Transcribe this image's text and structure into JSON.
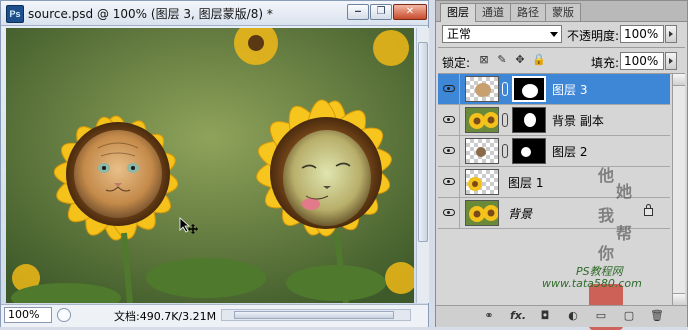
{
  "document": {
    "title": "source.psd @ 100% (图层 3, 图层蒙版/8) *",
    "app_icon": "Ps",
    "zoom": "100%",
    "doc_info": "文档:490.7K/3.21M",
    "buttons": {
      "minimize": "‒",
      "restore": "❐",
      "close": "✕"
    }
  },
  "panel": {
    "tabs": [
      {
        "label": "图层"
      },
      {
        "label": "通道"
      },
      {
        "label": "路径"
      },
      {
        "label": "蒙版"
      }
    ],
    "blend_mode": "正常",
    "opacity_label": "不透明度:",
    "opacity_value": "100%",
    "lock_label": "锁定:",
    "fill_label": "填充:",
    "fill_value": "100%",
    "layers": [
      {
        "name": "图层 3",
        "selected": true,
        "has_mask": true
      },
      {
        "name": "背景 副本",
        "selected": false,
        "has_mask": true
      },
      {
        "name": "图层 2",
        "selected": false,
        "has_mask": true
      },
      {
        "name": "图层 1",
        "selected": false,
        "has_mask": false
      },
      {
        "name": "背景",
        "selected": false,
        "has_mask": false,
        "locked": true
      }
    ],
    "watermark_chars": [
      "他",
      "她",
      "我",
      "帮",
      "你"
    ],
    "site_title": "PS教程网",
    "site_url": "www.tata580.com",
    "bottom_icons": [
      "link-icon",
      "fx-icon",
      "mask-icon",
      "adjustment-icon",
      "folder-icon",
      "new-layer-icon",
      "trash-icon"
    ],
    "bottom_glyphs": [
      "⚭",
      "fx.",
      "◘",
      "◐",
      "▭",
      "▢",
      "🗑"
    ]
  },
  "colors": {
    "selection_blue": "#3e86d6",
    "sunflower_yellow": "#f4c21a",
    "seal_red": "#c93a2e"
  }
}
